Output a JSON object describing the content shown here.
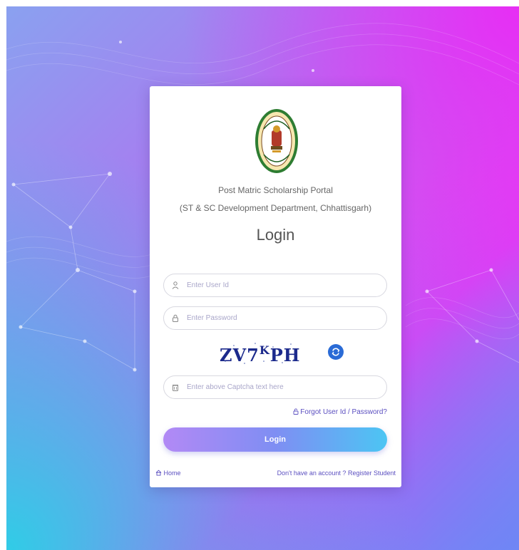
{
  "portal": {
    "title": "Post Matric Scholarship Portal",
    "subtitle": "(ST & SC Development Department, Chhattisgarh)"
  },
  "login": {
    "heading": "Login",
    "user_placeholder": "Enter User Id",
    "password_placeholder": "Enter Password",
    "captcha_text_main": "ZV7",
    "captcha_text_sup": "K",
    "captcha_text_end": "PH",
    "captcha_placeholder": "Enter above Captcha text here",
    "forgot_label": "Forgot User Id / Password?",
    "button_label": "Login"
  },
  "footer": {
    "home_label": "Home",
    "register_prefix": "Don't have an account ? ",
    "register_label": "Register Student"
  },
  "icons": {
    "user": "user-icon",
    "lock": "lock-icon",
    "captcha": "shield-icon",
    "refresh": "refresh-icon",
    "forgot": "lock-icon",
    "home": "home-icon",
    "emblem": "state-emblem"
  },
  "colors": {
    "accent": "#5b4fc0",
    "button_start": "#b289f5",
    "button_end": "#4cc5f3",
    "refresh": "#2a6bd6"
  }
}
